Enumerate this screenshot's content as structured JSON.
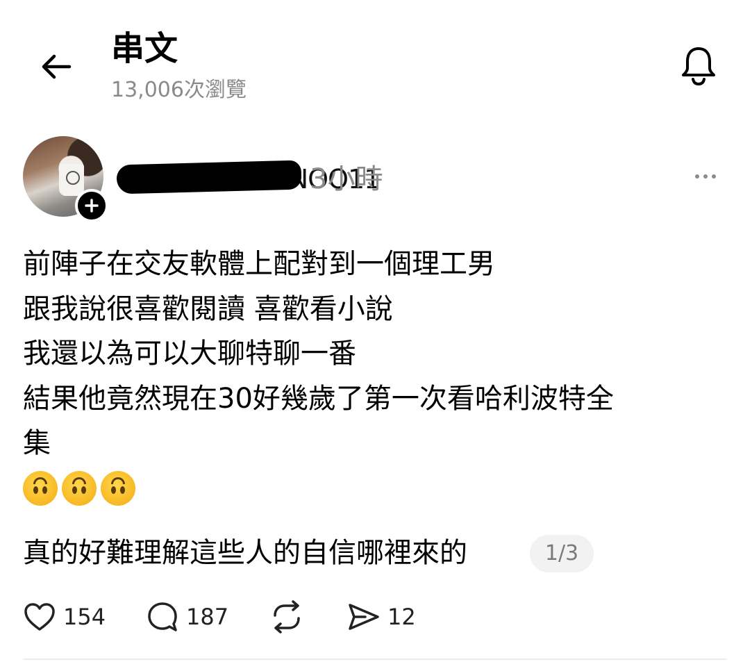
{
  "header": {
    "title": "串文",
    "views": "13,006次瀏覽"
  },
  "post": {
    "username_visible_tail": "ICNOO11",
    "timestamp": "3小時",
    "lines": [
      "前陣子在交友軟體上配對到一個理工男",
      "跟我說很喜歡閱讀 喜歡看小說",
      "我還以為可以大聊特聊一番",
      "結果他竟然現在30好幾歲了第一次看哈利波特全",
      "集"
    ],
    "emojis": [
      "upside-down-face",
      "upside-down-face",
      "upside-down-face"
    ],
    "last_line": "真的好難理解這些人的自信哪裡來的",
    "page_indicator": "1/3"
  },
  "actions": {
    "likes": "154",
    "replies": "187",
    "shares": "12"
  },
  "icons": {
    "back": "arrow-left-icon",
    "bell": "bell-icon",
    "more": "more-horizontal-icon",
    "follow": "plus-icon",
    "like": "heart-icon",
    "reply": "comment-icon",
    "repost": "repost-icon",
    "share": "send-icon"
  }
}
